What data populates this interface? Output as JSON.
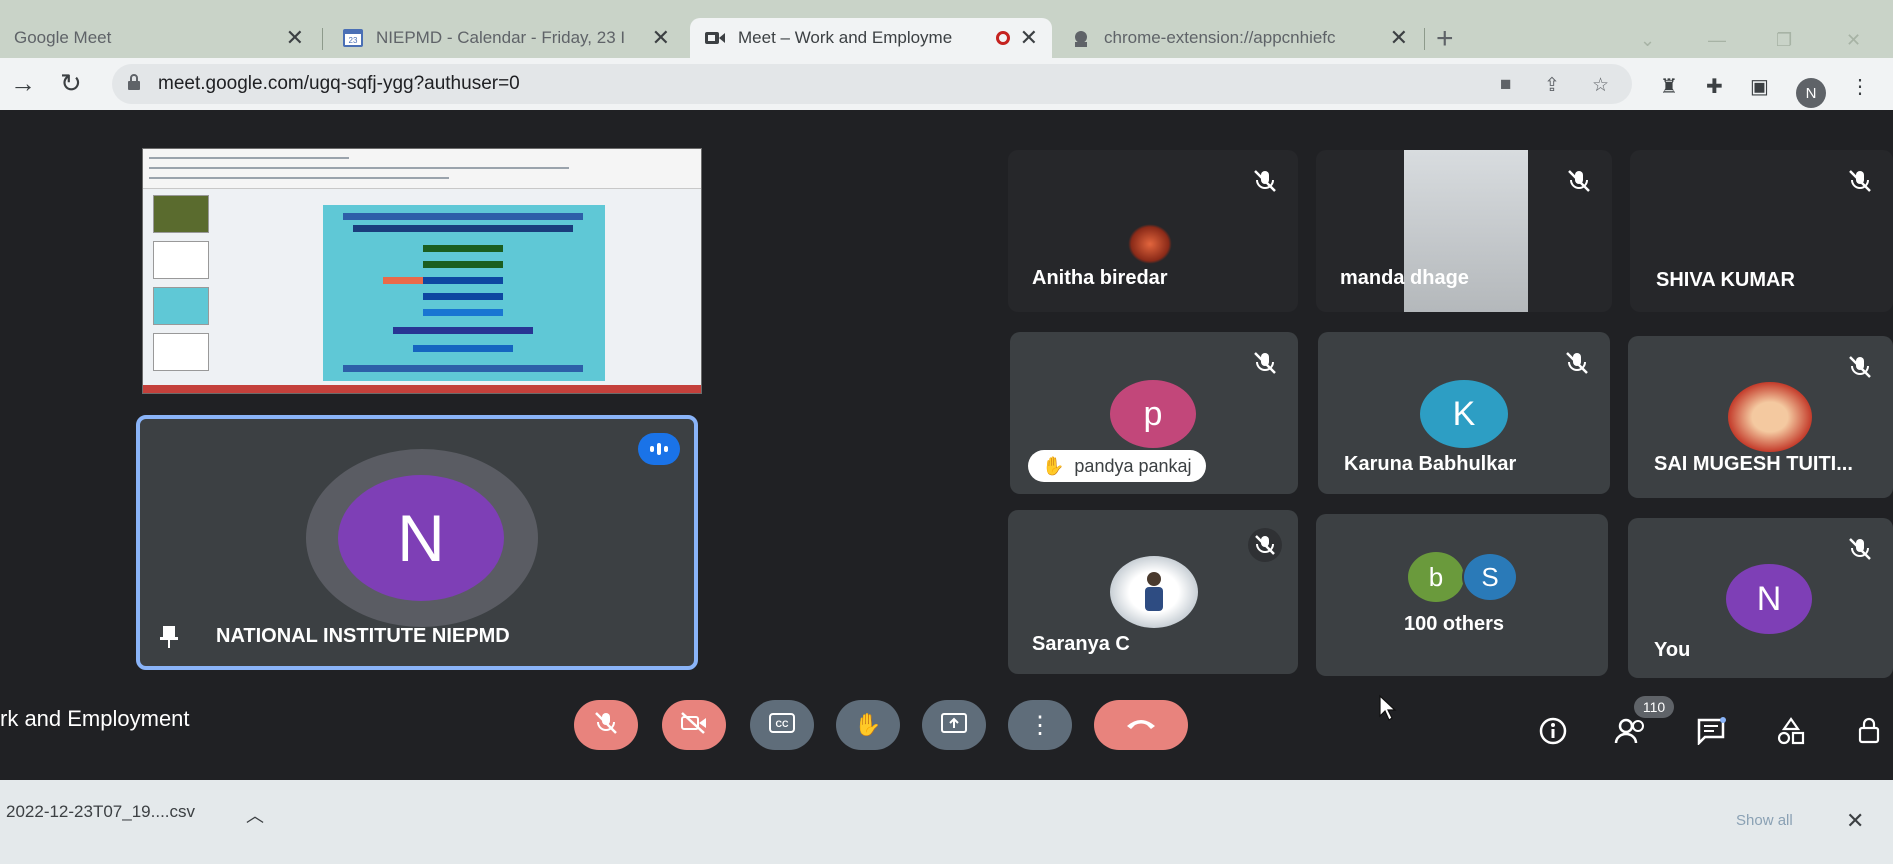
{
  "tabs": [
    {
      "title": "Google Meet",
      "icon": "meet-icon"
    },
    {
      "title": "NIEPMD - Calendar - Friday, 23 I",
      "icon": "calendar-icon",
      "icon_text": "23"
    },
    {
      "title": "Meet – Work and Employme",
      "icon": "meet-camera-icon"
    },
    {
      "title": "chrome-extension://appcnhiefc",
      "icon": "extension-icon"
    }
  ],
  "address_bar": {
    "url": "meet.google.com/ugq-sqfj-ygg?authuser=0"
  },
  "profile_initial": "N",
  "main_speaker": {
    "name": "NATIONAL INSTITUTE NIEPMD",
    "initial": "N",
    "avatar_color": "#7e3fb6"
  },
  "participants": [
    {
      "name": "Anitha biredar"
    },
    {
      "name": "manda dhage"
    },
    {
      "name": "SHIVA KUMAR"
    },
    {
      "name": "pandya pankaj",
      "initial": "p",
      "avatar_color": "#c2477a",
      "hand_raised": true
    },
    {
      "name": "Karuna Babhulkar",
      "initial": "K",
      "avatar_color": "#2d9ec4"
    },
    {
      "name": "SAI MUGESH TUITI..."
    },
    {
      "name": "Saranya C"
    },
    {
      "name": "100 others",
      "initials": [
        "b",
        "S"
      ]
    },
    {
      "name": "You",
      "initial": "N",
      "avatar_color": "#7e3fb6"
    }
  ],
  "meeting_title": "rk and Employment",
  "people_count": "110",
  "download": {
    "filename": "2022-12-23T07_19....csv",
    "show_all": "Show all"
  },
  "colors": {
    "accent": "#8ab4f8",
    "danger": "#e8837d",
    "tile": "#3c4043"
  }
}
